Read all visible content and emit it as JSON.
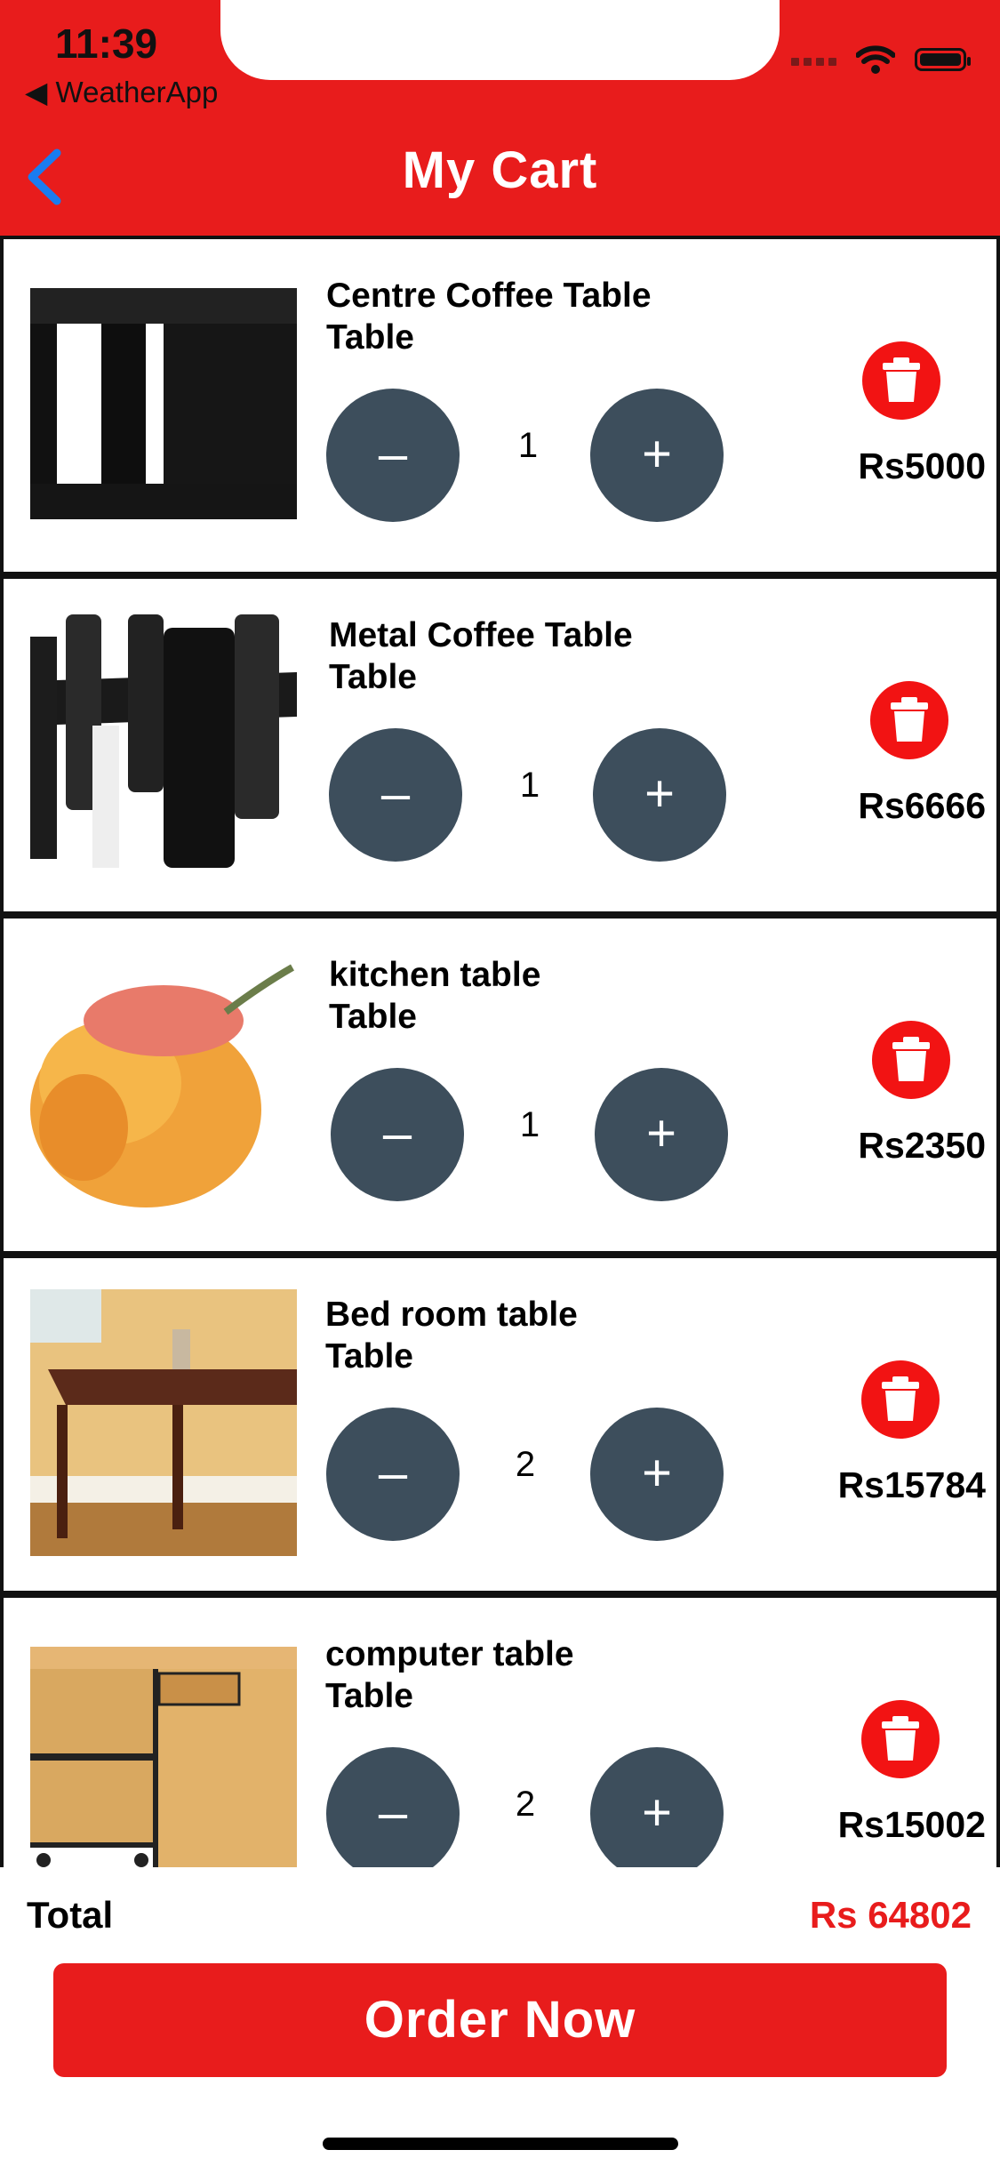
{
  "status_bar": {
    "time": "11:39",
    "back_app": "◀ WeatherApp"
  },
  "nav": {
    "title": "My Cart",
    "accent": "#e81c1c",
    "back_icon": "chevron-left-icon"
  },
  "cart": {
    "minus_label": "–",
    "plus_label": "+",
    "items": [
      {
        "title_line1": "Centre Coffee Table",
        "title_line2": "Table",
        "qty": "1",
        "price": "Rs5000"
      },
      {
        "title_line1": "Metal Coffee Table",
        "title_line2": "Table",
        "qty": "1",
        "price": "Rs6666"
      },
      {
        "title_line1": "kitchen table",
        "title_line2": "Table",
        "qty": "1",
        "price": "Rs2350"
      },
      {
        "title_line1": "Bed room table",
        "title_line2": "Table",
        "qty": "2",
        "price": "Rs15784"
      },
      {
        "title_line1": "computer table",
        "title_line2": "Table",
        "qty": "2",
        "price": "Rs15002"
      }
    ]
  },
  "footer": {
    "total_label": "Total",
    "total_value": "Rs 64802",
    "order_button": "Order Now"
  }
}
